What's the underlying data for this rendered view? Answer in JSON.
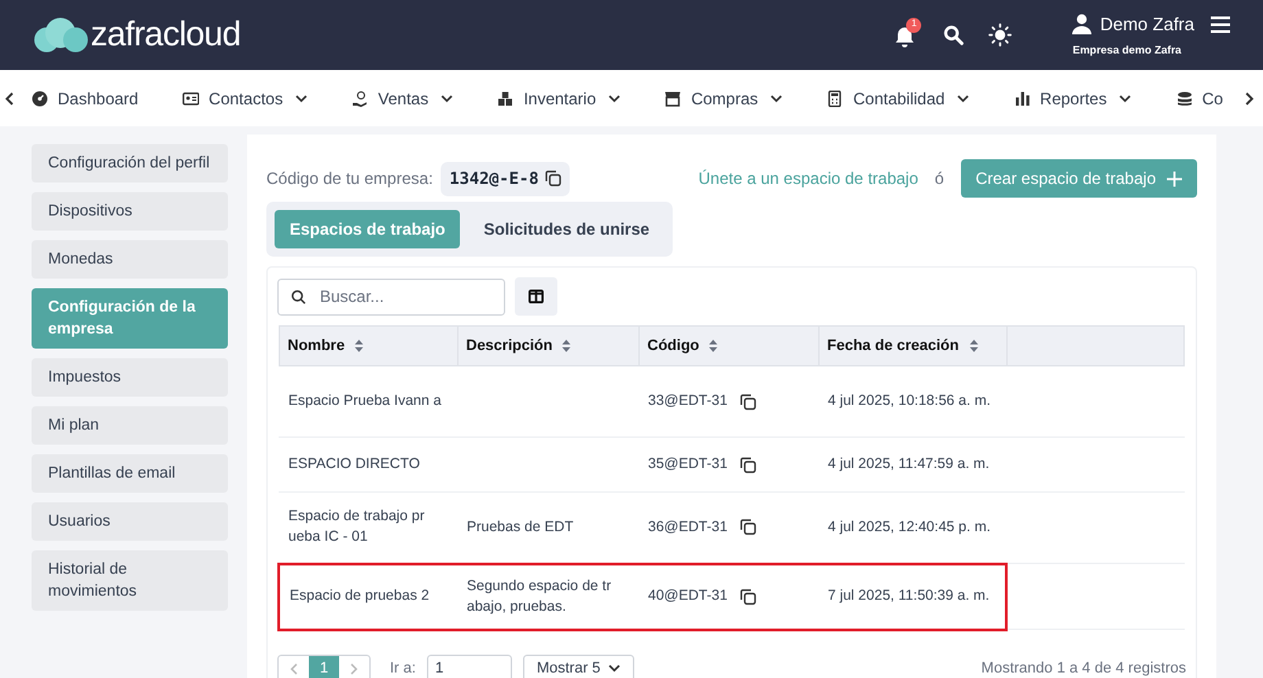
{
  "header": {
    "logo": "zafracloud",
    "notification_count": "1",
    "user_name": "Demo Zafra",
    "company": "Empresa demo Zafra"
  },
  "nav": [
    {
      "label": "Dashboard",
      "dropdown": false
    },
    {
      "label": "Contactos",
      "dropdown": true
    },
    {
      "label": "Ventas",
      "dropdown": true
    },
    {
      "label": "Inventario",
      "dropdown": true
    },
    {
      "label": "Compras",
      "dropdown": true
    },
    {
      "label": "Contabilidad",
      "dropdown": true
    },
    {
      "label": "Reportes",
      "dropdown": true
    },
    {
      "label": "Co",
      "dropdown": false
    }
  ],
  "sidebar": [
    {
      "label": "Configuración del perfil",
      "selected": false
    },
    {
      "label": "Dispositivos",
      "selected": false
    },
    {
      "label": "Monedas",
      "selected": false
    },
    {
      "label": "Configuración de la empresa",
      "selected": true
    },
    {
      "label": "Impuestos",
      "selected": false
    },
    {
      "label": "Mi plan",
      "selected": false
    },
    {
      "label": "Plantillas de email",
      "selected": false
    },
    {
      "label": "Usuarios",
      "selected": false
    },
    {
      "label": "Historial de movimientos",
      "selected": false
    }
  ],
  "company_code": {
    "label": "Código de tu empresa:",
    "value": "1342@-E-8"
  },
  "join_link": "Únete a un espacio de trabajo",
  "or": "ó",
  "create_button": "Crear espacio de trabajo",
  "tabs": [
    {
      "label": "Espacios de trabajo",
      "selected": true
    },
    {
      "label": "Solicitudes de unirse",
      "selected": false
    }
  ],
  "search": {
    "placeholder": "Buscar..."
  },
  "table": {
    "columns": [
      "Nombre",
      "Descripción",
      "Código",
      "Fecha de creación"
    ],
    "rows": [
      {
        "name": "Espacio Prueba Ivann a",
        "description": "",
        "code": "33@EDT-31",
        "date": "4 jul 2025, 10:18:56 a. m.",
        "highlighted": false
      },
      {
        "name": "ESPACIO DIRECTO",
        "description": "",
        "code": "35@EDT-31",
        "date": "4 jul 2025, 11:47:59 a. m.",
        "highlighted": false
      },
      {
        "name": "Espacio de trabajo pr ueba IC - 01",
        "description": "Pruebas de EDT",
        "code": "36@EDT-31",
        "date": "4 jul 2025, 12:40:45 p. m.",
        "highlighted": false
      },
      {
        "name": "Espacio de pruebas 2",
        "description": "Segundo espacio de tr abajo, pruebas.",
        "code": "40@EDT-31",
        "date": "7 jul 2025, 11:50:39 a. m.",
        "highlighted": true
      }
    ]
  },
  "pagination": {
    "page": "1",
    "goto_label": "Ir a:",
    "goto_value": "1",
    "page_size": "Mostrar 5",
    "summary": "Mostrando 1 a 4 de 4 registros"
  }
}
